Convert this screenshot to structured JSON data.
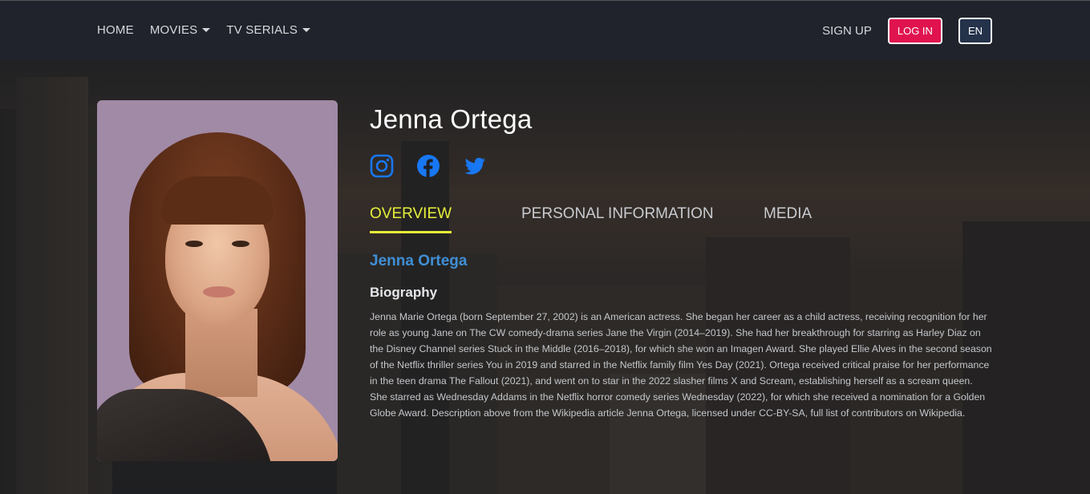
{
  "nav": {
    "home": "HOME",
    "movies": "MOVIES",
    "tv_serials": "TV SERIALS",
    "sign_up": "SIGN UP",
    "log_in": "LOG IN",
    "language": "EN"
  },
  "person": {
    "name": "Jenna Ortega",
    "socials": [
      "instagram-icon",
      "facebook-icon",
      "twitter-icon"
    ]
  },
  "tabs": [
    {
      "label": "OVERVIEW",
      "active": true
    },
    {
      "label": "PERSONAL INFORMATION",
      "active": false
    },
    {
      "label": "MEDIA",
      "active": false
    }
  ],
  "overview": {
    "title": "Jenna Ortega",
    "bio_heading": "Biography",
    "bio_text": "Jenna Marie Ortega (born September 27, 2002) is an American actress. She began her career as a child actress, receiving recognition for her role as young Jane on The CW comedy-drama series Jane the Virgin (2014–2019). She had her breakthrough for starring as Harley Diaz on the Disney Channel series Stuck in the Middle (2016–2018), for which she won an Imagen Award. She played Ellie Alves in the second season of the Netflix thriller series You in 2019 and starred in the Netflix family film Yes Day (2021). Ortega received critical praise for her performance in the teen drama The Fallout (2021), and went on to star in the 2022 slasher films X and Scream, establishing herself as a scream queen. She starred as Wednesday Addams in the Netflix horror comedy series Wednesday (2022), for which she received a nomination for a Golden Globe Award. Description above from the Wikipedia article Jenna Ortega, licensed under CC-BY-SA, full list of contributors on Wikipedia."
  },
  "colors": {
    "accent_tab": "#e6f03a",
    "link_blue": "#3f8fd6",
    "login_red": "#e0134f",
    "social_blue": "#1877f2"
  }
}
